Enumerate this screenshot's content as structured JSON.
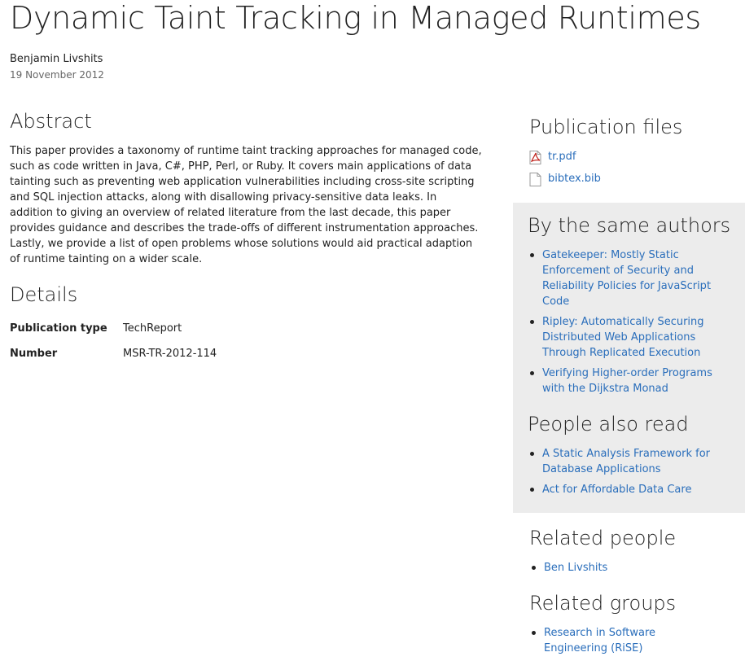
{
  "title": "Dynamic Taint Tracking in Managed Runtimes",
  "author": "Benjamin Livshits",
  "date": "19 November 2012",
  "abstract": {
    "heading": "Abstract",
    "text": "This paper provides a taxonomy of runtime taint tracking approaches for managed code, such as code written in Java, C#, PHP, Perl, or Ruby. It covers main applications of data tainting such as preventing web application vulnerabilities including cross-site scripting and SQL injection attacks, along with disallowing privacy-sensitive data leaks. In addition to giving an overview of related literature from the last decade, this paper provides guidance and describes the trade-offs of different instrumentation approaches. Lastly, we provide a list of open problems whose solutions would aid practical adaption of runtime tainting on a wider scale."
  },
  "details": {
    "heading": "Details",
    "rows": [
      {
        "key": "Publication type",
        "value": "TechReport"
      },
      {
        "key": "Number",
        "value": "MSR-TR-2012-114"
      }
    ]
  },
  "publication_files": {
    "heading": "Publication files",
    "files": [
      {
        "name": "tr.pdf",
        "icon": "pdf-file-icon"
      },
      {
        "name": "bibtex.bib",
        "icon": "document-file-icon"
      }
    ]
  },
  "same_authors": {
    "heading": "By the same authors",
    "items": [
      "Gatekeeper: Mostly Static Enforcement of Security and Reliability Policies for JavaScript Code",
      "Ripley: Automatically Securing Distributed Web Applications Through Replicated Execution",
      "Verifying Higher-order Programs with the Dijkstra Monad"
    ]
  },
  "people_also_read": {
    "heading": "People also read",
    "items": [
      "A Static Analysis Framework for Database Applications",
      "Act for Affordable Data Care"
    ]
  },
  "related_people": {
    "heading": "Related people",
    "items": [
      "Ben Livshits"
    ]
  },
  "related_groups": {
    "heading": "Related groups",
    "items": [
      "Research in Software Engineering (RiSE)"
    ]
  },
  "colors": {
    "link": "#2a6ebb",
    "panel_background": "#ececec",
    "pdf_icon": "#c0211a"
  }
}
